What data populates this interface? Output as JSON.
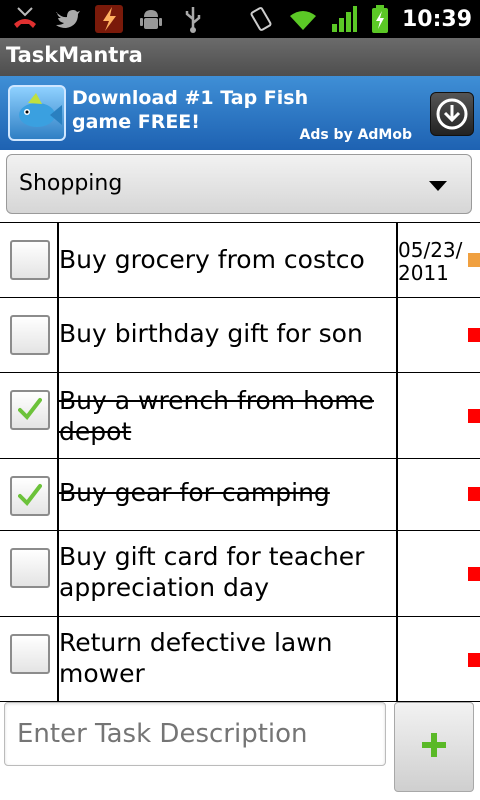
{
  "status_bar": {
    "time": "10:39",
    "icons": [
      "missed-call-icon",
      "twitter-icon",
      "flash-app-icon",
      "android-debug-icon",
      "usb-icon",
      "vibrate-icon",
      "wifi-icon",
      "signal-icon",
      "battery-charging-icon"
    ]
  },
  "app": {
    "title": "TaskMantra"
  },
  "ad": {
    "headline": "Download #1 Tap Fish game FREE!",
    "byline": "Ads by AdMob",
    "colors": {
      "background": "#2a73c2"
    }
  },
  "category": {
    "selected": "Shopping"
  },
  "tasks": [
    {
      "text": "Buy grocery from costco",
      "done": false,
      "date": "05/23/\n2011",
      "priority_color": "#f0a040"
    },
    {
      "text": "Buy birthday gift for son",
      "done": false,
      "date": "",
      "priority_color": "#ff0000"
    },
    {
      "text": "Buy a wrench from home depot",
      "done": true,
      "date": "",
      "priority_color": "#ff0000"
    },
    {
      "text": "Buy gear for camping",
      "done": true,
      "date": "",
      "priority_color": "#ff0000"
    },
    {
      "text": "Buy gift card for teacher appreciation day",
      "done": false,
      "date": "",
      "priority_color": "#ff0000"
    },
    {
      "text": "Return defective lawn mower",
      "done": false,
      "date": "",
      "priority_color": "#ff0000"
    }
  ],
  "new_task": {
    "placeholder": "Enter Task Description",
    "value": ""
  },
  "add_button": {
    "icon": "plus-icon"
  }
}
